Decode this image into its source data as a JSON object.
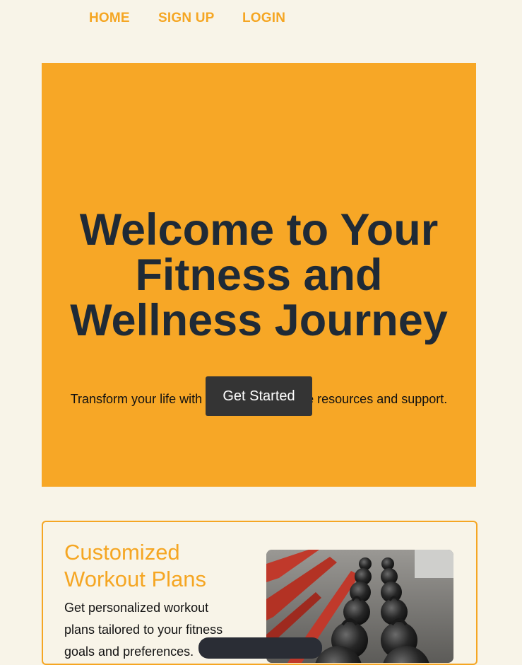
{
  "nav": {
    "items": [
      {
        "label": "HOME"
      },
      {
        "label": "SIGN UP"
      },
      {
        "label": "LOGIN"
      }
    ]
  },
  "hero": {
    "title": "Welcome to Your Fitness and Wellness Journey",
    "subtitle": "Transform your life with our comprehensive resources and support.",
    "cta_label": "Get Started"
  },
  "feature": {
    "title": "Customized Workout Plans",
    "text": "Get personalized workout plans tailored to your fitness goals and preferences.",
    "image_alt": "kettlebells"
  },
  "colors": {
    "accent": "#f5a623",
    "hero_bg": "#f7a726",
    "page_bg": "#f8f4e8",
    "heading_dark": "#1f2a36",
    "button_bg": "#343434"
  }
}
